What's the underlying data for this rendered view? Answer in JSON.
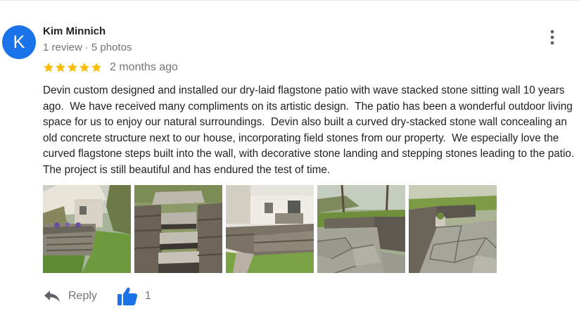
{
  "review": {
    "avatar_letter": "K",
    "avatar_color": "#1a73e8",
    "reviewer_name": "Kim Minnich",
    "review_count": "1 review",
    "photo_count": "5 photos",
    "separator": "·",
    "rating": 5,
    "rating_max": 5,
    "star_color": "#fbbc04",
    "date": "2 months ago",
    "text": "Devin custom designed and installed our dry-laid flagstone patio with wave stacked stone sitting wall 10 years ago.  We have received many compliments on its artistic design.  The patio has been a wonderful outdoor living space for us to enjoy our natural surroundings.  Devin also built a curved dry-stacked stone wall concealing an old concrete structure next to our house, incorporating field stones from our property.  We especially love the curved flagstone steps built into the wall, with decorative stone landing and stepping stones leading to the patio.  The project is still beautiful and has endured the test of time."
  },
  "photos": [
    {
      "subject": "stone retaining wall with flowers by house"
    },
    {
      "subject": "flagstone steps between stone walls"
    },
    {
      "subject": "curved stone wall with patio chairs"
    },
    {
      "subject": "flagstone patio with stone bench wall"
    },
    {
      "subject": "flagstone patio with planter on wall"
    }
  ],
  "actions": {
    "reply_label": "Reply",
    "like_count": "1",
    "like_color": "#1a73e8"
  },
  "icons": {
    "more": "more-vert-icon",
    "reply": "reply-arrow-icon",
    "like": "thumb-up-icon",
    "star": "star-icon"
  }
}
